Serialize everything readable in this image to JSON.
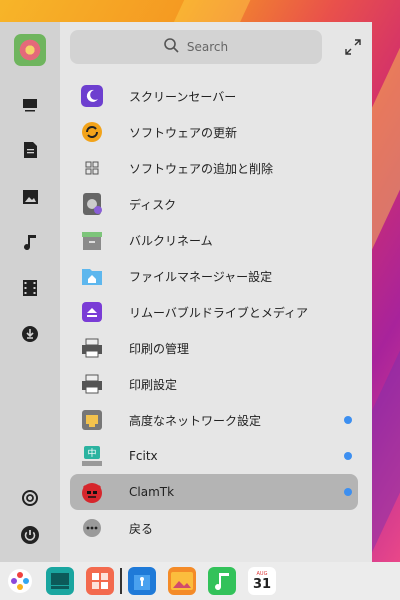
{
  "search": {
    "placeholder": "Search"
  },
  "menu": {
    "items": [
      {
        "label": "スクリーンセーバー",
        "icon": "screensaver-icon",
        "has_dot": false
      },
      {
        "label": "ソフトウェアの更新",
        "icon": "software-update-icon",
        "has_dot": false
      },
      {
        "label": "ソフトウェアの追加と削除",
        "icon": "add-remove-software-icon",
        "has_dot": false
      },
      {
        "label": "ディスク",
        "icon": "disks-icon",
        "has_dot": false
      },
      {
        "label": "バルクリネーム",
        "icon": "bulk-rename-icon",
        "has_dot": false
      },
      {
        "label": "ファイルマネージャー設定",
        "icon": "file-manager-settings-icon",
        "has_dot": false
      },
      {
        "label": "リムーバブルドライブとメディア",
        "icon": "removable-drives-icon",
        "has_dot": false
      },
      {
        "label": "印刷の管理",
        "icon": "print-manager-icon",
        "has_dot": false
      },
      {
        "label": "印刷設定",
        "icon": "print-settings-icon",
        "has_dot": false
      },
      {
        "label": "高度なネットワーク設定",
        "icon": "network-settings-icon",
        "has_dot": true
      },
      {
        "label": "Fcitx",
        "icon": "fcitx-icon",
        "has_dot": true
      },
      {
        "label": "ClamTk",
        "icon": "clamtk-icon",
        "has_dot": true,
        "selected": true
      }
    ],
    "back_label": "戻る"
  },
  "rail": {
    "icons": [
      "computer-icon",
      "documents-icon",
      "pictures-icon",
      "music-icon",
      "videos-icon",
      "downloads-icon",
      "settings-icon",
      "power-icon"
    ]
  },
  "dock": {
    "icons": [
      "launcher-icon",
      "multitasking-icon",
      "appstore-icon",
      "file-manager-icon",
      "image-viewer-icon",
      "music-player-icon",
      "calendar-icon"
    ],
    "calendar_month": "AUG",
    "calendar_day": "31"
  },
  "colors": {
    "accent_dot": "#3d8ff0",
    "selected_bg": "#b4b4b4"
  }
}
